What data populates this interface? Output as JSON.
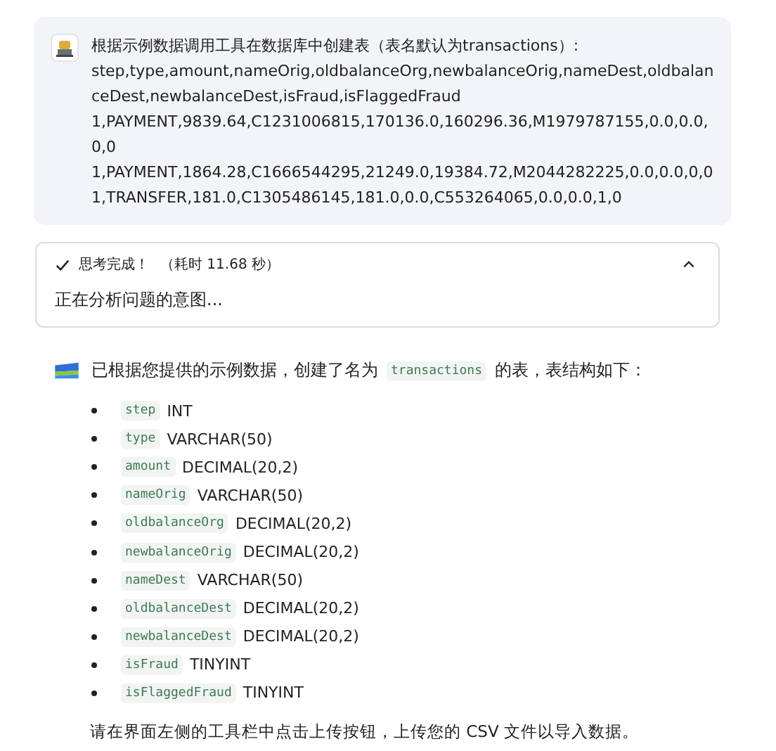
{
  "user_message": {
    "prompt": "根据示例数据调用工具在数据库中创建表（表名默认为transactions）:",
    "data_lines": [
      "step,type,amount,nameOrig,oldbalanceOrg,newbalanceOrig,nameDest,oldbalanceDest,newbalanceDest,isFraud,isFlaggedFraud",
      "1,PAYMENT,9839.64,C1231006815,170136.0,160296.36,M1979787155,0.0,0.0,0,0",
      "1,PAYMENT,1864.28,C1666544295,21249.0,19384.72,M2044282225,0.0,0.0,0,0",
      "1,TRANSFER,181.0,C1305486145,181.0,0.0,C553264065,0.0,0.0,1,0"
    ]
  },
  "thinking": {
    "status": "思考完成！",
    "elapsed": "（耗时 11.68 秒）",
    "expanded": true,
    "content": "正在分析问题的意图..."
  },
  "answer": {
    "intro_before": "已根据您提供的示例数据，创建了名为",
    "intro_code": "transactions",
    "intro_after": "的表，表结构如下：",
    "columns": [
      {
        "name": "step",
        "type": "INT"
      },
      {
        "name": "type",
        "type": "VARCHAR(50)"
      },
      {
        "name": "amount",
        "type": "DECIMAL(20,2)"
      },
      {
        "name": "nameOrig",
        "type": "VARCHAR(50)"
      },
      {
        "name": "oldbalanceOrg",
        "type": "DECIMAL(20,2)"
      },
      {
        "name": "newbalanceOrig",
        "type": "DECIMAL(20,2)"
      },
      {
        "name": "nameDest",
        "type": "VARCHAR(50)"
      },
      {
        "name": "oldbalanceDest",
        "type": "DECIMAL(20,2)"
      },
      {
        "name": "newbalanceDest",
        "type": "DECIMAL(20,2)"
      },
      {
        "name": "isFraud",
        "type": "TINYINT"
      },
      {
        "name": "isFlaggedFraud",
        "type": "TINYINT"
      }
    ],
    "footer": "请在界面左侧的工具栏中点击上传按钮，上传您的 CSV 文件以导入数据。"
  }
}
